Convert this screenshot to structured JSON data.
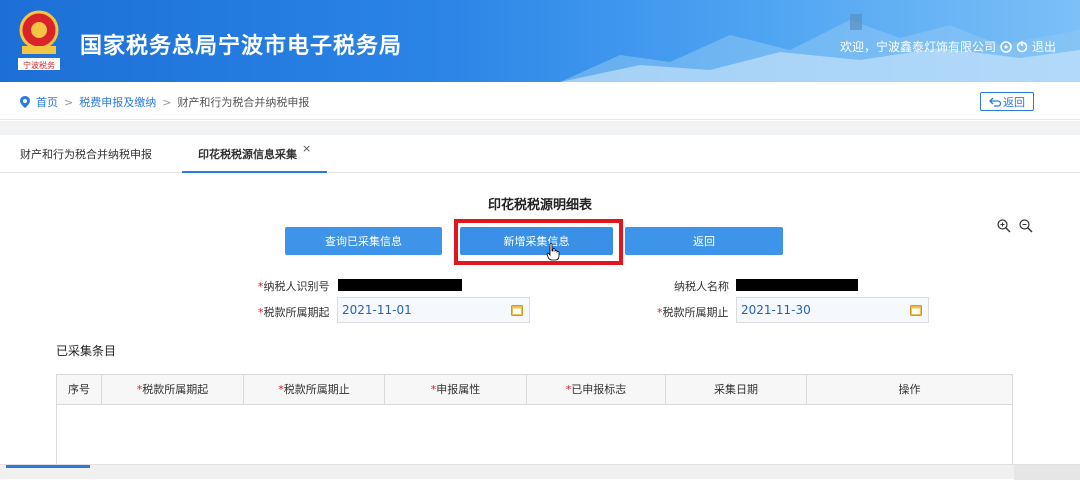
{
  "header": {
    "title": "国家税务总局宁波市电子税务局",
    "emblem_caption": "宁波税务",
    "welcome": "欢迎，宁波鑫泰灯饰有限公司",
    "logout": "退出"
  },
  "breadcrumb": {
    "home": "首页",
    "level2": "税费申报及缴纳",
    "current": "财产和行为税合并纳税申报",
    "back_label": "返回"
  },
  "tabs": [
    {
      "label": "财产和行为税合并纳税申报",
      "active": false
    },
    {
      "label": "印花税税源信息采集",
      "active": true,
      "close": "×"
    }
  ],
  "form": {
    "title": "印花税税源明细表",
    "buttons": {
      "query": "查询已采集信息",
      "add": "新增采集信息",
      "back": "返回"
    },
    "fields": {
      "taxpayer_id_label": "纳税人识别号",
      "taxpayer_name_label": "纳税人名称",
      "period_start_label": "税款所属期起",
      "period_start_value": "2021-11-01",
      "period_end_label": "税款所属期止",
      "period_end_value": "2021-11-30",
      "required_mark": "*"
    }
  },
  "collected": {
    "section_title": "已采集条目",
    "columns": [
      {
        "label": "序号",
        "required": false
      },
      {
        "label": "税款所属期起",
        "required": true
      },
      {
        "label": "税款所属期止",
        "required": true
      },
      {
        "label": "申报属性",
        "required": true
      },
      {
        "label": "已申报标志",
        "required": true
      },
      {
        "label": "采集日期",
        "required": false
      },
      {
        "label": "操作",
        "required": false
      }
    ],
    "rows": []
  },
  "colors": {
    "accent": "#2a7ae2",
    "button": "#3d94e8",
    "highlight": "#e0151d"
  }
}
